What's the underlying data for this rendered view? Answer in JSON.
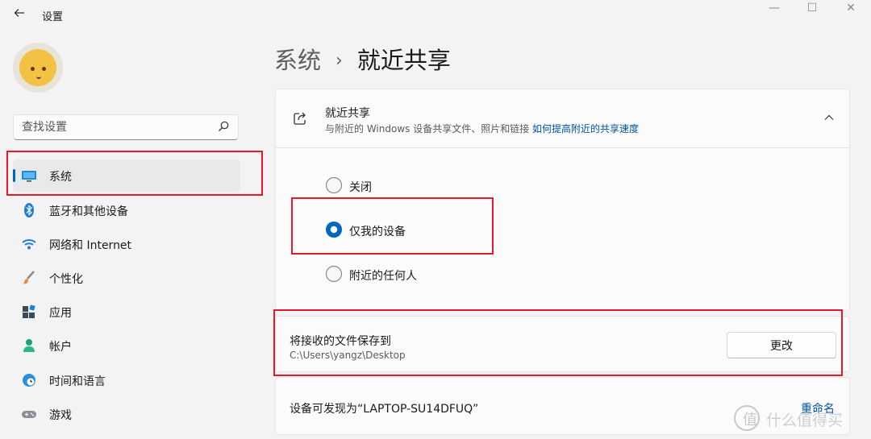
{
  "window": {
    "title": "设置",
    "controls": {
      "minimize": "—",
      "maximize": "☐",
      "close": "✕"
    }
  },
  "search": {
    "placeholder": "查找设置"
  },
  "sidebar": {
    "items": [
      {
        "label": "系统",
        "icon": "monitor-icon",
        "selected": true
      },
      {
        "label": "蓝牙和其他设备",
        "icon": "bluetooth-icon"
      },
      {
        "label": "网络和 Internet",
        "icon": "wifi-icon"
      },
      {
        "label": "个性化",
        "icon": "brush-icon"
      },
      {
        "label": "应用",
        "icon": "apps-icon"
      },
      {
        "label": "帐户",
        "icon": "person-icon"
      },
      {
        "label": "时间和语言",
        "icon": "globe-clock-icon"
      },
      {
        "label": "游戏",
        "icon": "gamepad-icon"
      }
    ]
  },
  "breadcrumb": {
    "parent": "系统",
    "separator": "›",
    "current": "就近共享"
  },
  "nearby_sharing": {
    "title": "就近共享",
    "description": "与附近的 Windows 设备共享文件、照片和链接",
    "link": "如何提高附近的共享速度",
    "options": [
      {
        "label": "关闭",
        "selected": false
      },
      {
        "label": "仅我的设备",
        "selected": true
      },
      {
        "label": "附近的任何人",
        "selected": false
      }
    ]
  },
  "save_location": {
    "title": "将接收的文件保存到",
    "path": "C:\\Users\\yangz\\Desktop",
    "button": "更改"
  },
  "discoverable": {
    "label": "设备可发现为“LAPTOP-SU14DFUQ”",
    "action": "重命名"
  },
  "watermark": {
    "mark": "值",
    "text": "什么值得买"
  },
  "colors": {
    "accent": "#0067c0",
    "highlight": "#e8182b",
    "link": "#0053a6"
  }
}
